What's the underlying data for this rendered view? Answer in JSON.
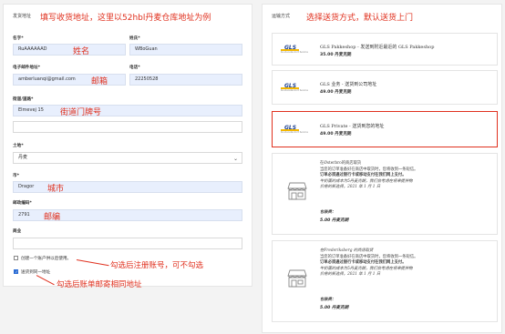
{
  "colors": {
    "annotation": "#e0301e",
    "input_bg": "#e8effd",
    "highlight_border": "#e0301e",
    "gls_blue": "#1b3f8f",
    "gls_yellow": "#f5b800"
  },
  "shipping_address": {
    "header": "发货地址",
    "annotation": "填写收货地址，这里以52hbl丹麦仓库地址为例",
    "first_name": {
      "label": "名字*",
      "value": "RuAAAAAAD",
      "annotation": "姓名"
    },
    "last_name": {
      "label": "姓氏*",
      "value": "WBoGuan"
    },
    "email": {
      "label": "电子邮件地址*",
      "value": "amberluanqi@gmail.com",
      "annotation": "邮箱"
    },
    "phone": {
      "label": "电话*",
      "value": "22250528"
    },
    "street": {
      "label": "街道/道路*",
      "value": "Elmevej 15",
      "annotation": "街道门牌号"
    },
    "street2": {
      "value": ""
    },
    "country": {
      "label": "土地*",
      "value": "丹麦"
    },
    "city": {
      "label": "市*",
      "value": "Dragor",
      "annotation": "城市"
    },
    "postcode": {
      "label": "邮政编码*",
      "value": "2791",
      "annotation": "邮编"
    },
    "company": {
      "label": "商业",
      "value": ""
    },
    "create_account": {
      "label": "创建一个账户供以后使用。",
      "checked": false,
      "annotation": "勾选后注册账号，可不勾选"
    },
    "same_billing": {
      "label": "送货到同一地址",
      "checked": true,
      "annotation": "勾选后账单邮寄相同地址"
    }
  },
  "shipping_method": {
    "header": "运输方式",
    "annotation": "选择送货方式，默认送货上门",
    "options": [
      {
        "logo": "GLS",
        "logo_tag": "Kundenstandort Service",
        "title": "GLS Pakkeshop - 发送到附近最近的 GLS Pakkeshop",
        "price": "35.00 丹麦克朗",
        "selected": false
      },
      {
        "logo": "GLS",
        "logo_tag": "Kundenstandort Service",
        "title": "GLS 业务 - 送货到公司地址",
        "price": "49.00 丹麦克朗",
        "selected": false
      },
      {
        "logo": "GLS",
        "logo_tag": "Kundenstandort Service",
        "title": "GLS Private - 送货到您的地址",
        "price": "49.00 丹麦克朗",
        "selected": true
      }
    ],
    "pickups": [
      {
        "icon": "store-icon",
        "lines": [
          "在Østerbro的商店取货",
          "当您的订单准备好在商店中取货时，您将收到一条短信。",
          "订单必须通过银行卡或移动支付在我们网上支付。",
          "牛奶面的成本为5丹麦克朗，我们会考虑在将来提供物",
          "价格的新选择。2021 年 1 月 1 日"
        ],
        "price_label": "包装费：",
        "price": "5.00 丹麦克朗"
      },
      {
        "icon": "store-icon",
        "lines": [
          "在Frederiksberg 的商店取货",
          "当您的订单准备好在商店中取货时，您将收到一条短信。",
          "订单必须通过银行卡或移动支付在我们网上支付。",
          "牛奶面的成本为5丹麦克朗，我们会考虑在将来提供物",
          "价格的新选择。2021 年 1 月 1 日"
        ],
        "price_label": "包装费：",
        "price": "5.00 丹麦克朗"
      }
    ]
  }
}
